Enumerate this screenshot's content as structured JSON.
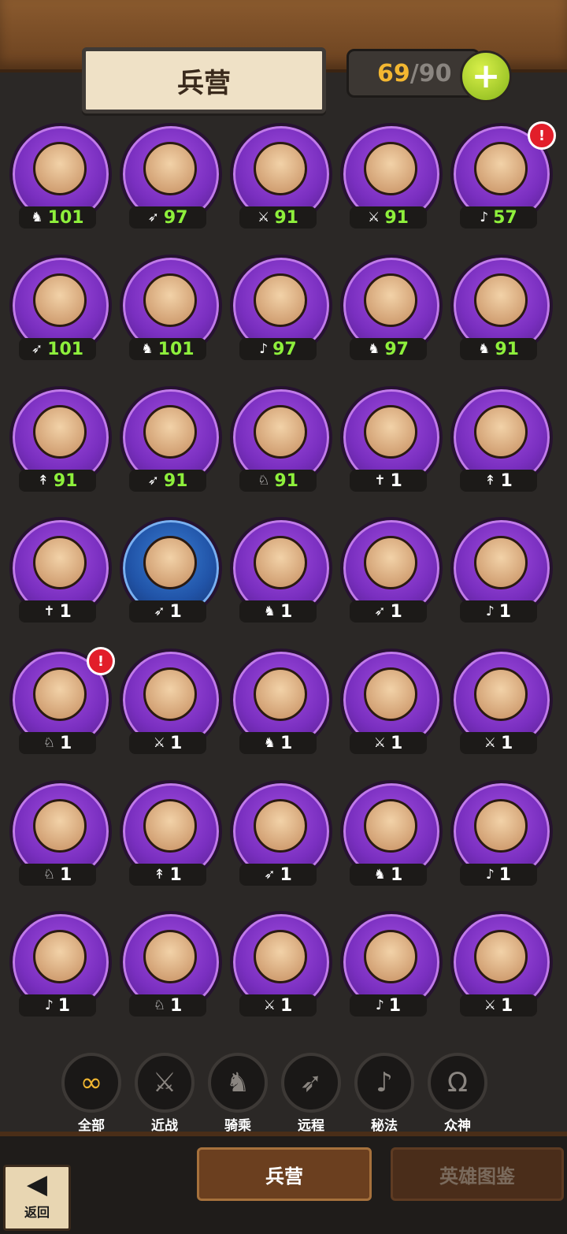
{
  "header": {
    "title": "兵营",
    "count_current": "69",
    "count_slash": "/",
    "count_max": "90",
    "add_icon": "plus-icon"
  },
  "colors": {
    "badge_purple": "#7a2fc0",
    "badge_blue": "#2154a8",
    "level_green": "#8ef03c",
    "count_orange": "#f3b731",
    "alert_red": "#e21e2a"
  },
  "units": [
    {
      "class_icon": "♞",
      "level": "101",
      "green": true,
      "badge": "purple",
      "alert": false
    },
    {
      "class_icon": "➶",
      "level": "97",
      "green": true,
      "badge": "purple",
      "alert": false
    },
    {
      "class_icon": "⚔",
      "level": "91",
      "green": true,
      "badge": "purple",
      "alert": false
    },
    {
      "class_icon": "⚔",
      "level": "91",
      "green": true,
      "badge": "purple",
      "alert": false
    },
    {
      "class_icon": "♪",
      "level": "57",
      "green": true,
      "badge": "purple",
      "alert": true
    },
    {
      "class_icon": "➶",
      "level": "101",
      "green": true,
      "badge": "purple",
      "alert": false
    },
    {
      "class_icon": "♞",
      "level": "101",
      "green": true,
      "badge": "purple",
      "alert": false
    },
    {
      "class_icon": "♪",
      "level": "97",
      "green": true,
      "badge": "purple",
      "alert": false
    },
    {
      "class_icon": "♞",
      "level": "97",
      "green": true,
      "badge": "purple",
      "alert": false
    },
    {
      "class_icon": "♞",
      "level": "91",
      "green": true,
      "badge": "purple",
      "alert": false
    },
    {
      "class_icon": "↟",
      "level": "91",
      "green": true,
      "badge": "purple",
      "alert": false
    },
    {
      "class_icon": "➶",
      "level": "91",
      "green": true,
      "badge": "purple",
      "alert": false
    },
    {
      "class_icon": "♘",
      "level": "91",
      "green": true,
      "badge": "purple",
      "alert": false
    },
    {
      "class_icon": "✝",
      "level": "1",
      "green": false,
      "badge": "purple",
      "alert": false
    },
    {
      "class_icon": "↟",
      "level": "1",
      "green": false,
      "badge": "purple",
      "alert": false
    },
    {
      "class_icon": "✝",
      "level": "1",
      "green": false,
      "badge": "purple",
      "alert": false
    },
    {
      "class_icon": "➶",
      "level": "1",
      "green": false,
      "badge": "blue",
      "alert": false
    },
    {
      "class_icon": "♞",
      "level": "1",
      "green": false,
      "badge": "purple",
      "alert": false
    },
    {
      "class_icon": "➶",
      "level": "1",
      "green": false,
      "badge": "purple",
      "alert": false
    },
    {
      "class_icon": "♪",
      "level": "1",
      "green": false,
      "badge": "purple",
      "alert": false
    },
    {
      "class_icon": "♘",
      "level": "1",
      "green": false,
      "badge": "purple",
      "alert": true
    },
    {
      "class_icon": "⚔",
      "level": "1",
      "green": false,
      "badge": "purple",
      "alert": false
    },
    {
      "class_icon": "♞",
      "level": "1",
      "green": false,
      "badge": "purple",
      "alert": false
    },
    {
      "class_icon": "⚔",
      "level": "1",
      "green": false,
      "badge": "purple",
      "alert": false
    },
    {
      "class_icon": "⚔",
      "level": "1",
      "green": false,
      "badge": "purple",
      "alert": false
    },
    {
      "class_icon": "♘",
      "level": "1",
      "green": false,
      "badge": "purple",
      "alert": false
    },
    {
      "class_icon": "↟",
      "level": "1",
      "green": false,
      "badge": "purple",
      "alert": false
    },
    {
      "class_icon": "➶",
      "level": "1",
      "green": false,
      "badge": "purple",
      "alert": false
    },
    {
      "class_icon": "♞",
      "level": "1",
      "green": false,
      "badge": "purple",
      "alert": false
    },
    {
      "class_icon": "♪",
      "level": "1",
      "green": false,
      "badge": "purple",
      "alert": false
    },
    {
      "class_icon": "♪",
      "level": "1",
      "green": false,
      "badge": "purple",
      "alert": false
    },
    {
      "class_icon": "♘",
      "level": "1",
      "green": false,
      "badge": "purple",
      "alert": false
    },
    {
      "class_icon": "⚔",
      "level": "1",
      "green": false,
      "badge": "purple",
      "alert": false
    },
    {
      "class_icon": "♪",
      "level": "1",
      "green": false,
      "badge": "purple",
      "alert": false
    },
    {
      "class_icon": "⚔",
      "level": "1",
      "green": false,
      "badge": "purple",
      "alert": false
    }
  ],
  "filters": [
    {
      "icon": "∞",
      "label": "全部",
      "active": true
    },
    {
      "icon": "⚔",
      "label": "近战",
      "active": false
    },
    {
      "icon": "♞",
      "label": "骑乘",
      "active": false
    },
    {
      "icon": "➶",
      "label": "远程",
      "active": false
    },
    {
      "icon": "♪",
      "label": "秘法",
      "active": false
    },
    {
      "icon": "Ω",
      "label": "众神",
      "active": false
    }
  ],
  "tabs": {
    "barracks": "兵营",
    "heroes": "英雄图鉴"
  },
  "back": {
    "icon": "◀",
    "label": "返回"
  }
}
